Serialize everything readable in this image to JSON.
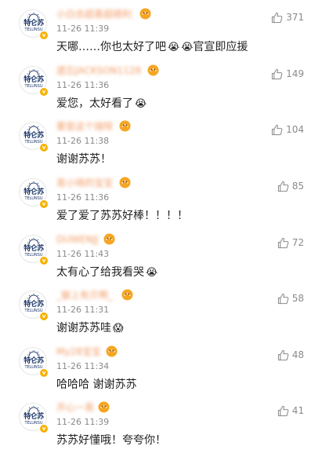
{
  "comments": [
    {
      "username": "小白合超喜超顺利",
      "time": "11-26 11:39",
      "text": "天哪……你也太好了吧",
      "text_suffix": "官宣即应援",
      "emojis": [
        "😭",
        "😭"
      ],
      "likes": "371",
      "avatar": {
        "brand": "特仑苏",
        "sub": "TELUNSU"
      }
    },
    {
      "username": "遗忘JACKSON1128",
      "time": "11-26 11:36",
      "text": "爱您，太好看了",
      "text_suffix": "",
      "emojis": [
        "😭"
      ],
      "likes": "149",
      "avatar": {
        "brand": "特仑苏",
        "sub": "TELUNSU"
      }
    },
    {
      "username": "要是这个瑞呀",
      "time": "11-26 11:38",
      "text": "谢谢苏苏！",
      "text_suffix": "",
      "emojis": [],
      "likes": "104",
      "avatar": {
        "brand": "特仑苏",
        "sub": "TELUNSU"
      }
    },
    {
      "username": "易小琦的宝宝",
      "time": "11-26 11:36",
      "text": "爱了爱了苏苏好棒！！！！",
      "text_suffix": "",
      "emojis": [],
      "likes": "85",
      "avatar": {
        "brand": "特仑苏",
        "sub": "TELUNSU"
      }
    },
    {
      "username": "DUWENJJ",
      "time": "11-26 11:43",
      "text": "太有心了给我看哭",
      "text_suffix": "",
      "emojis": [
        "😭"
      ],
      "likes": "72",
      "avatar": {
        "brand": "特仑苏",
        "sub": "TELUNSU"
      }
    },
    {
      "username": "_御上有贝啊_",
      "time": "11-26 11:31",
      "text": "谢谢苏苏哇",
      "text_suffix": "",
      "emojis": [
        "😱"
      ],
      "likes": "58",
      "avatar": {
        "brand": "特仑苏",
        "sub": "TELUNSU"
      }
    },
    {
      "username": "My28宝宝",
      "time": "11-26 11:34",
      "text": "哈哈哈 谢谢苏苏",
      "text_suffix": "",
      "emojis": [],
      "likes": "48",
      "avatar": {
        "brand": "特仑苏",
        "sub": "TELUNSU"
      }
    },
    {
      "username": "开心一易",
      "time": "11-26 11:39",
      "text": "苏苏好懂哦！夸夸你！",
      "text_suffix": "",
      "emojis": [],
      "likes": "41",
      "avatar": {
        "brand": "特仑苏",
        "sub": "TELUNSU"
      }
    }
  ],
  "colors": {
    "username": "#f08a4b",
    "badge": "#f6b100",
    "meta": "#8a8a8a"
  },
  "icons": {
    "like": "thumbs-up-icon",
    "verified": "verified-v-icon",
    "fan": "fan-badge-icon"
  }
}
